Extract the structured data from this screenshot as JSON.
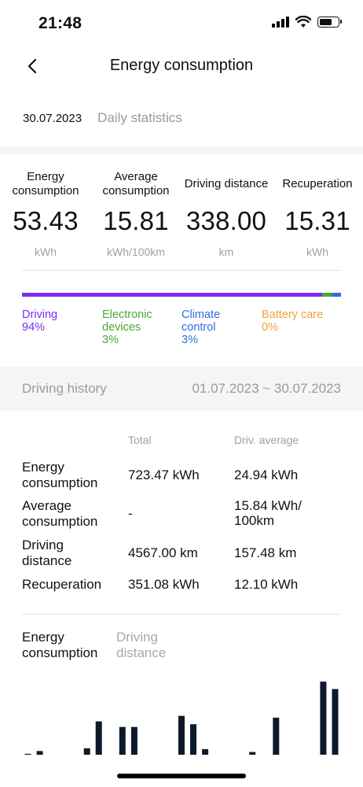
{
  "status_bar": {
    "time": "21:48"
  },
  "nav": {
    "title": "Energy consumption"
  },
  "date_row": {
    "date": "30.07.2023",
    "mode": "Daily statistics"
  },
  "stats": [
    {
      "label": "Energy consumption",
      "value": "53.43",
      "unit": "kWh"
    },
    {
      "label": "Average consumption",
      "value": "15.81",
      "unit": "kWh/100km"
    },
    {
      "label": "Driving distance",
      "value": "338.00",
      "unit": "km"
    },
    {
      "label": "Recuperation",
      "value": "15.31",
      "unit": "kWh"
    }
  ],
  "breakdown": [
    {
      "name": "Driving",
      "percent_label": "94%",
      "percent": 94,
      "color": "#7b2cf0"
    },
    {
      "name": "Electronic devices",
      "percent_label": "3%",
      "percent": 3,
      "color": "#4aa832"
    },
    {
      "name": "Climate control",
      "percent_label": "3%",
      "percent": 3,
      "color": "#2f6fe0"
    },
    {
      "name": "Battery care",
      "percent_label": "0%",
      "percent": 0,
      "color": "#f0a23c"
    }
  ],
  "history": {
    "title": "Driving history",
    "range": "01.07.2023 ~ 30.07.2023",
    "col_total": "Total",
    "col_avg": "Driv. average",
    "rows": [
      {
        "label": "Energy consumption",
        "total": "723.47 kWh",
        "avg": "24.94 kWh"
      },
      {
        "label": "Average consumption",
        "total": "-",
        "avg": "15.84 kWh/ 100km"
      },
      {
        "label": "Driving distance",
        "total": "4567.00 km",
        "avg": "157.48 km"
      },
      {
        "label": "Recuperation",
        "total": "351.08 kWh",
        "avg": "12.10 kWh"
      }
    ]
  },
  "chart_tabs": {
    "active": "Energy consumption",
    "inactive": "Driving distance"
  },
  "chart_data": {
    "type": "bar",
    "ylim": [
      0,
      85
    ],
    "values": [
      1,
      4,
      0,
      0,
      0,
      7,
      36,
      0,
      30,
      30,
      0,
      0,
      0,
      42,
      33,
      6,
      0,
      0,
      0,
      3,
      0,
      40,
      0,
      0,
      0,
      79,
      71
    ],
    "color": "#0d1a2b"
  }
}
